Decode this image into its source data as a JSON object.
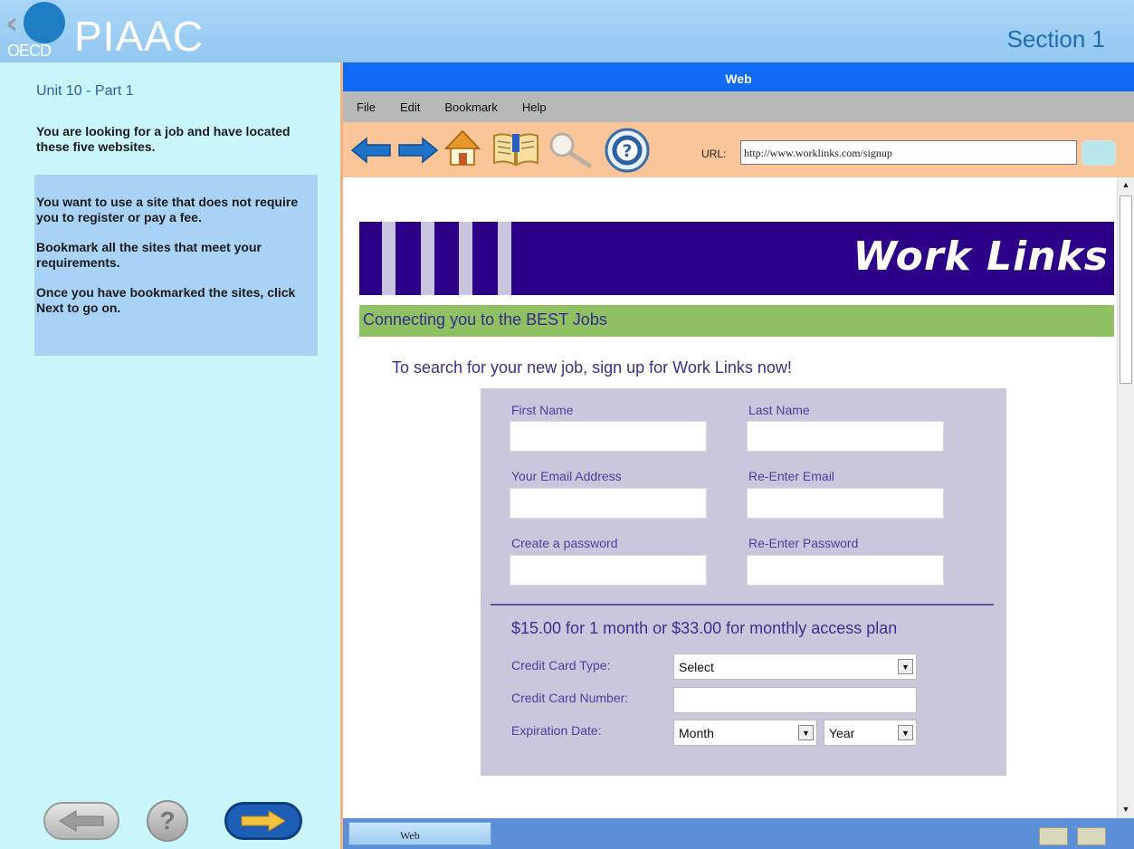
{
  "header": {
    "logo_small": "OECD",
    "logo_large": "PIAAC",
    "section": "Section 1"
  },
  "left_panel": {
    "unit_title": "Unit 10 - Part 1",
    "intro": "You are looking for a job and have located these five websites.",
    "task": [
      "You want to use a site that does not require you to register or pay a fee.",
      "Bookmark all the sites that meet your requirements.",
      "Once you have bookmarked the sites, click Next to go on."
    ],
    "help_label": "?"
  },
  "browser": {
    "title": "Web",
    "menu": [
      "File",
      "Edit",
      "Bookmark",
      "Help"
    ],
    "url_label": "URL:",
    "url": "http://www.worklinks.com/signup",
    "taskbar_tab": "Web"
  },
  "page": {
    "brand": "Work Links",
    "tagline": "Connecting you to the BEST Jobs",
    "signup_message": "To search for your new job, sign up for Work Links now!",
    "form": {
      "first_name": "First Name",
      "last_name": "Last Name",
      "email": "Your Email Address",
      "re_email": "Re-Enter Email",
      "password": "Create a password",
      "re_password": "Re-Enter Password",
      "price": "$15.00 for 1 month or $33.00 for monthly access plan",
      "cc_type_label": "Credit Card Type:",
      "cc_type_value": "Select",
      "cc_number_label": "Credit Card Number:",
      "expiration_label": "Expiration Date:",
      "month_value": "Month",
      "year_value": "Year"
    }
  },
  "colors": {
    "banner": "#2d0088",
    "tagline_bg": "#8fc062",
    "form_bg": "#cac7dc",
    "title_bar": "#0f6bf5",
    "toolbar": "#fac598",
    "left_panel": "#c9f6fb"
  },
  "icons": [
    "back-arrow-icon",
    "forward-arrow-icon",
    "home-icon",
    "bookmark-book-icon",
    "search-icon",
    "help-icon"
  ]
}
